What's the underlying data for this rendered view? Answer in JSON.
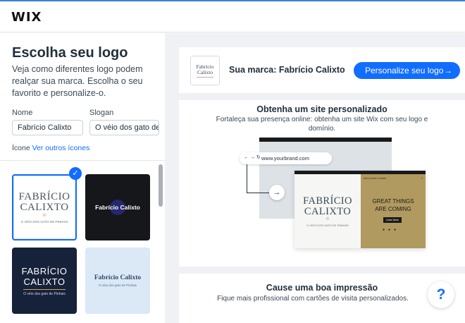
{
  "app": {
    "logo": "WIX"
  },
  "left": {
    "title": "Escolha seu logo",
    "description": "Veja como diferentes logo podem realçar sua marca. Escolha o seu favorito e personalize-o.",
    "name_label": "Nome",
    "name_value": "Fabrício Calixto",
    "slogan_label": "Slogan",
    "slogan_value": "O véio dos gato de",
    "icon_label": "Ícone",
    "icon_link": "Ver outros ícones",
    "logos": [
      {
        "name_line1": "FABRÍCIO",
        "name_line2": "CALIXTO",
        "tagline": "O VÉIO DOS GATO DE PINHAIS",
        "selected": true,
        "background": "#ffffff"
      },
      {
        "name": "Fabrício Calixto",
        "tagline": "",
        "background": "#15171a"
      },
      {
        "name_line1": "FABRÍCIO",
        "name_line2": "CALIXTO",
        "tagline": "O véio dos gato de Pinhais",
        "background": "#16213a"
      },
      {
        "name": "Fabrício Calixto",
        "tagline": "O véio dos gato de Pinhais",
        "background": "#dbe8f6"
      }
    ],
    "check_icon": "checkmark-icon"
  },
  "brand": {
    "thumb_line1": "Fabrício",
    "thumb_line2": "Calixto",
    "text": "Sua marca: Fabrício Calixto",
    "cta": "Personalize seu logo",
    "cta_icon": "arrow-right-icon"
  },
  "site": {
    "title": "Obtenha um site personalizado",
    "subtitle_line1": "Fortaleça sua presença online: obtenha um site Wix com seu logo e",
    "subtitle_line2": "domínio.",
    "url": "www.yourbrand.com",
    "nav": "← → ↻",
    "mock_name_line1": "FABRÍCIO",
    "mock_name_line2": "CALIXTO",
    "mock_tagline": "O VÉIO DOS GATO DE PINHAIS",
    "mock_head": "Menu   Sobre   Contato",
    "great_line1": "GREAT THINGS",
    "great_line2": "ARE COMING",
    "learn_more": "Learn More",
    "accent": "#b19a5f"
  },
  "impression": {
    "title": "Cause uma boa impressão",
    "subtitle": "Fique mais profissional com cartões de visita personalizados."
  },
  "help": {
    "label": "?"
  },
  "colors": {
    "primary": "#116dff",
    "text": "#20303c"
  }
}
